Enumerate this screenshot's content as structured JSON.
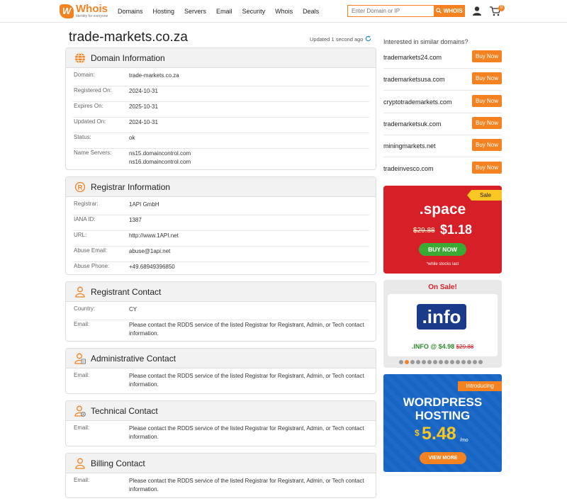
{
  "header": {
    "logo_word": "Whois",
    "logo_tagline": "Identity for everyone",
    "nav": [
      "Domains",
      "Hosting",
      "Servers",
      "Email",
      "Security",
      "Whois",
      "Deals"
    ],
    "search_placeholder": "Enter Domain or IP",
    "search_button": "WHOIS",
    "cart_count": "0",
    "accent_color": "#f58220"
  },
  "page": {
    "title": "trade-markets.co.za",
    "updated": "Updated 1 second ago"
  },
  "domain_info": {
    "heading": "Domain Information",
    "rows": [
      {
        "key": "Domain:",
        "value": "trade-markets.co.za"
      },
      {
        "key": "Registered On:",
        "value": "2024-10-31"
      },
      {
        "key": "Expires On:",
        "value": "2025-10-31"
      },
      {
        "key": "Updated On:",
        "value": "2024-10-31"
      },
      {
        "key": "Status:",
        "value": "ok"
      },
      {
        "key": "Name Servers:",
        "value": "ns15.domaincontrol.com",
        "value2": "ns16.domaincontrol.com"
      }
    ]
  },
  "registrar_info": {
    "heading": "Registrar Information",
    "rows": [
      {
        "key": "Registrar:",
        "value": "1API GmbH"
      },
      {
        "key": "IANA ID:",
        "value": "1387"
      },
      {
        "key": "URL:",
        "value": "http://www.1API.net"
      },
      {
        "key": "Abuse Email:",
        "value": "abuse@1api.net"
      },
      {
        "key": "Abuse Phone:",
        "value": "+49.68949396850"
      }
    ]
  },
  "registrant_contact": {
    "heading": "Registrant Contact",
    "rows": [
      {
        "key": "Country:",
        "value": "CY"
      },
      {
        "key": "Email:",
        "value": "Please contact the RDDS service of the listed Registrar for Registrant, Admin, or Tech contact information."
      }
    ]
  },
  "admin_contact": {
    "heading": "Administrative Contact",
    "rows": [
      {
        "key": "Email:",
        "value": "Please contact the RDDS service of the listed Registrar for Registrant, Admin, or Tech contact information."
      }
    ]
  },
  "tech_contact": {
    "heading": "Technical Contact",
    "rows": [
      {
        "key": "Email:",
        "value": "Please contact the RDDS service of the listed Registrar for Registrant, Admin, or Tech contact information."
      }
    ]
  },
  "billing_contact": {
    "heading": "Billing Contact",
    "rows": [
      {
        "key": "Email:",
        "value": "Please contact the RDDS service of the listed Registrar for Registrant, Admin, or Tech contact information."
      }
    ]
  },
  "similar": {
    "title": "Interested in similar domains?",
    "buy_label": "Buy Now",
    "domains": [
      "trademarkets24.com",
      "trademarketsusa.com",
      "cryptotrademarkets.com",
      "trademarketsuk.com",
      "miningmarkets.net",
      "tradeinvesco.com"
    ]
  },
  "promo_space": {
    "ribbon": "Sale",
    "tld": ".space",
    "old_price": "$29.88",
    "new_price": "$1.18",
    "button": "BUY NOW",
    "note": "*while stocks last",
    "bg_color": "#d71f27"
  },
  "promo_info": {
    "heading": "On Sale!",
    "logo": ".info",
    "price": ".INFO @ $4.98",
    "old_price": "$29.88",
    "active_slide": 2,
    "slide_count": 15
  },
  "promo_wp": {
    "badge": "Introducing",
    "title_line1": "WORDPRESS",
    "title_line2": "HOSTING",
    "currency": "$",
    "price": "5.48",
    "per": "/mo",
    "button": "VIEW MORE"
  }
}
